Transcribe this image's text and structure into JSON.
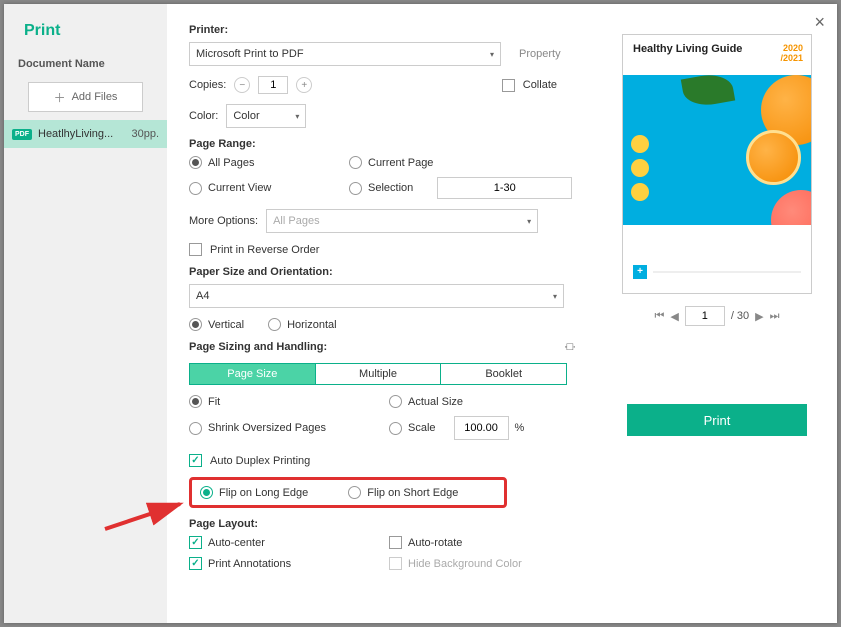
{
  "title": "Print",
  "sidebar": {
    "document_name_label": "Document Name",
    "add_files_label": "Add Files",
    "file": {
      "name": "HeatlhyLiving...",
      "pages": "30pp."
    }
  },
  "printer": {
    "label": "Printer:",
    "selected": "Microsoft Print to PDF",
    "property_link": "Property"
  },
  "copies": {
    "label": "Copies:",
    "value": "1"
  },
  "collate_label": "Collate",
  "color": {
    "label": "Color:",
    "selected": "Color"
  },
  "page_range": {
    "label": "Page Range:",
    "all_pages": "All Pages",
    "current_page": "Current Page",
    "current_view": "Current View",
    "selection": "Selection",
    "range_value": "1-30"
  },
  "more_options": {
    "label": "More Options:",
    "selected": "All Pages"
  },
  "reverse_label": "Print in Reverse Order",
  "paper": {
    "label": "Paper Size and Orientation:",
    "size": "A4",
    "vertical": "Vertical",
    "horizontal": "Horizontal"
  },
  "sizing": {
    "label": "Page Sizing and Handling:",
    "tabs": {
      "page_size": "Page Size",
      "multiple": "Multiple",
      "booklet": "Booklet"
    },
    "fit": "Fit",
    "actual": "Actual Size",
    "shrink": "Shrink Oversized Pages",
    "scale": "Scale",
    "scale_value": "100.00",
    "percent": "%"
  },
  "duplex": {
    "auto": "Auto Duplex Printing",
    "long_edge": "Flip on Long Edge",
    "short_edge": "Flip on Short Edge"
  },
  "layout": {
    "label": "Page Layout:",
    "auto_center": "Auto-center",
    "auto_rotate": "Auto-rotate",
    "annotations": "Print Annotations",
    "hide_bg": "Hide Background Color"
  },
  "preview": {
    "title": "Healthy Living Guide",
    "year1": "2020",
    "year2": "/2021",
    "nav_page": "1",
    "nav_total": "/ 30"
  },
  "print_button": "Print"
}
